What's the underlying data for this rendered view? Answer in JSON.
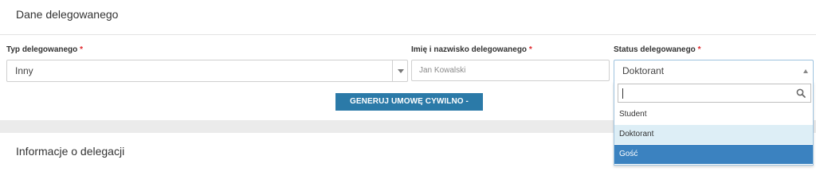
{
  "section1": {
    "title": "Dane delegowanego"
  },
  "fields": {
    "typ": {
      "label": "Typ delegowanego",
      "required_mark": "*",
      "value": "Inny"
    },
    "imie": {
      "label": "Imię i nazwisko delegowanego",
      "required_mark": "*",
      "placeholder": "Jan Kowalski",
      "value": ""
    },
    "status": {
      "label": "Status delegowanego",
      "required_mark": "*",
      "value": "Doktorant"
    }
  },
  "generate_button": {
    "label": "GENERUJ UMOWĘ CYWILNO - PRAWNĄ"
  },
  "section2": {
    "title": "Informacje o delegacji"
  },
  "status_dropdown": {
    "search_value": "",
    "options": [
      "Student",
      "Doktorant",
      "Gość"
    ],
    "hovered_option": "Doktorant",
    "highlighted_option": "Gość"
  },
  "colors": {
    "button_bg": "#2b7aa8",
    "required": "#e0252a",
    "option_highlight": "#3b82c0",
    "option_hover": "#ddeef6",
    "section_band": "#ebebeb"
  },
  "icons": {
    "typ_arrow": "chevron-down-icon",
    "status_arrow": "chevron-up-icon",
    "search": "search-icon"
  }
}
